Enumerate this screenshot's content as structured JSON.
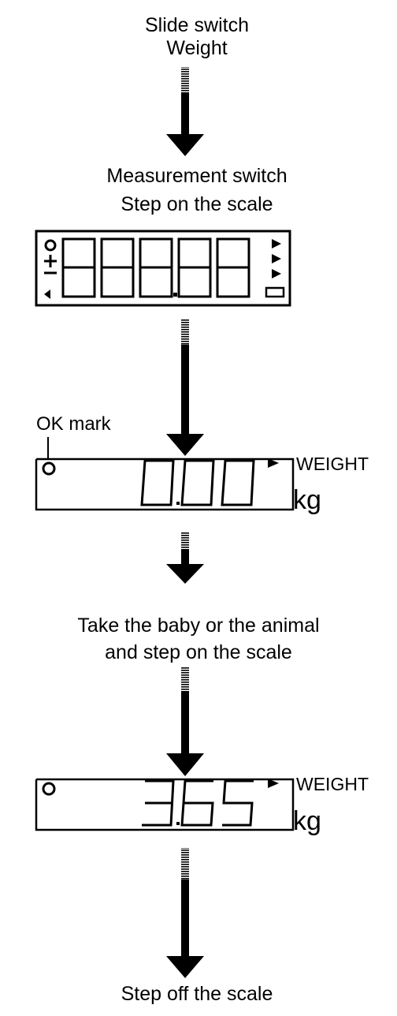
{
  "steps": {
    "s1_line1": "Slide switch",
    "s1_line2": "Weight",
    "s2_line1": "Measurement switch",
    "s2_line2": "Step on the scale",
    "s3_line1": "Take the baby or the animal",
    "s3_line2": "and step on the scale",
    "s4_line1": "Step off the scale"
  },
  "callouts": {
    "ok_mark": "OK mark"
  },
  "displays": {
    "test": {
      "text": "88888",
      "description": "all segments on"
    },
    "zero": {
      "reading": "0.00",
      "mode": "WEIGHT",
      "unit": "kg"
    },
    "measured": {
      "reading": "3.65",
      "mode": "WEIGHT",
      "unit": "kg"
    }
  },
  "icons": [
    "down-arrow-icon",
    "ok-mark-icon",
    "mode-indicator-icon",
    "tare-icon",
    "battery-icon"
  ]
}
